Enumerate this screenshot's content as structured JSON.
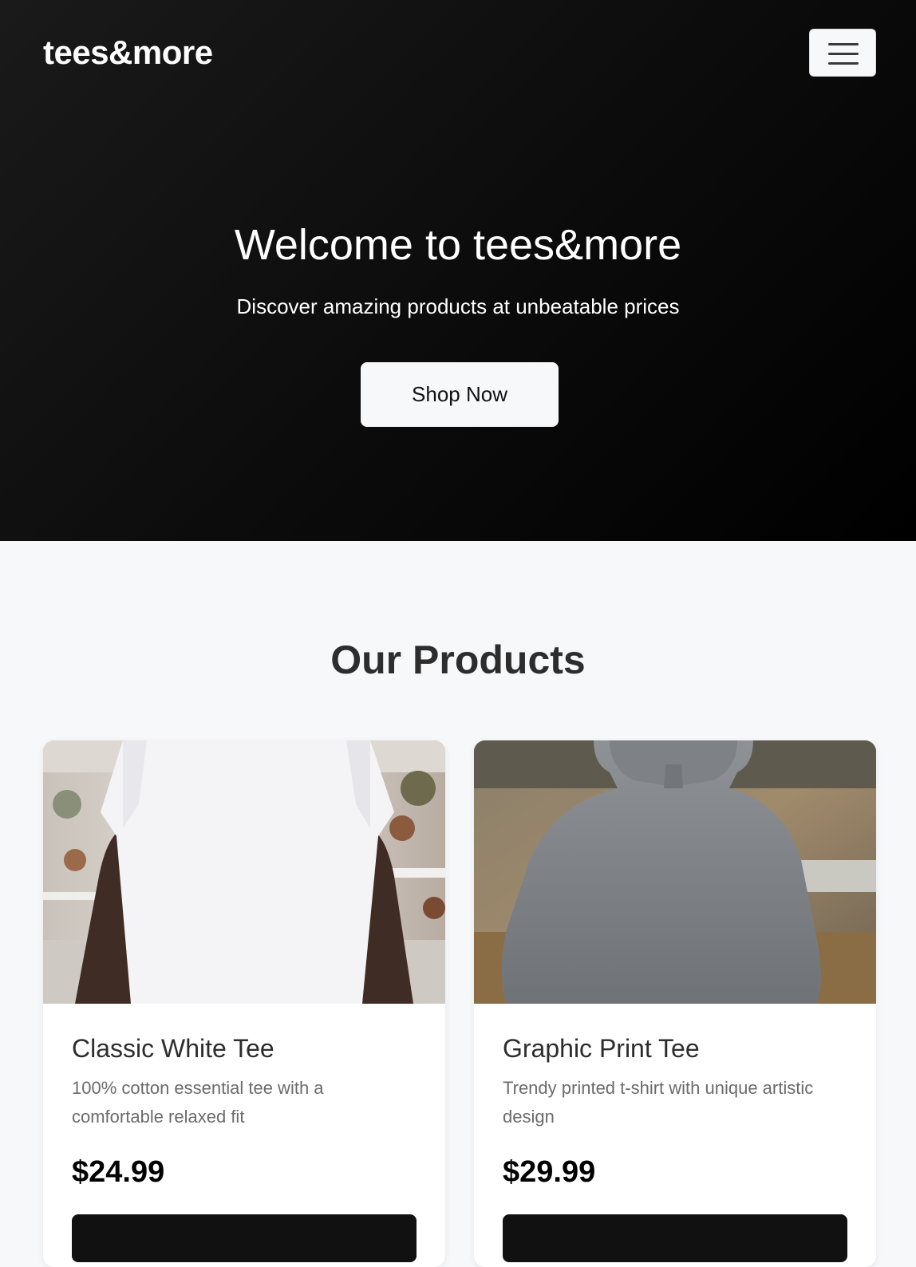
{
  "navbar": {
    "brand": "tees&more",
    "menu_icon": "hamburger-menu-icon"
  },
  "hero": {
    "title": "Welcome to tees&more",
    "subtitle": "Discover amazing products at unbeatable prices",
    "cta_label": "Shop Now"
  },
  "products": {
    "section_title": "Our Products",
    "items": [
      {
        "name": "Classic White Tee",
        "description": "100% cotton essential tee with a comfortable relaxed fit",
        "price": "$24.99"
      },
      {
        "name": "Graphic Print Tee",
        "description": "Trendy printed t-shirt with unique artistic design",
        "price": "$29.99"
      }
    ]
  },
  "colors": {
    "hero_bg": "#0b0b0b",
    "accent": "#111111",
    "page_bg": "#f7f8fa"
  }
}
